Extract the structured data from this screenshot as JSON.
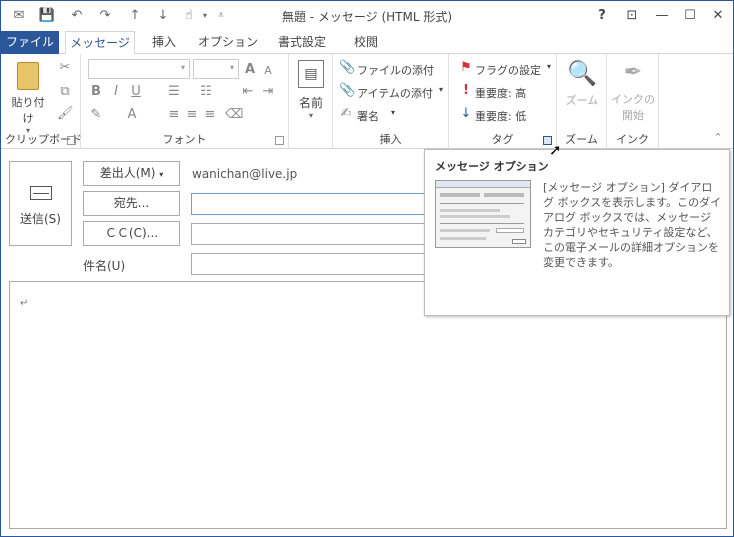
{
  "window": {
    "title": "無題 - メッセージ (HTML 形式)"
  },
  "title_controls": {
    "help": "?",
    "restore_ribbon": "⊡",
    "minimize": "—",
    "maximize": "☐",
    "close": "✕"
  },
  "tabs": [
    {
      "label": "ファイル"
    },
    {
      "label": "メッセージ"
    },
    {
      "label": "挿入"
    },
    {
      "label": "オプション"
    },
    {
      "label": "書式設定"
    },
    {
      "label": "校閲"
    }
  ],
  "ribbon": {
    "clipboard": {
      "paste": "貼り付け",
      "label": "クリップボード"
    },
    "font": {
      "label": "フォント"
    },
    "names": {
      "label": "名前"
    },
    "insert": {
      "attach_file": "ファイルの添付",
      "attach_item": "アイテムの添付",
      "signature": "署名",
      "label": "挿入"
    },
    "tags": {
      "flag": "フラグの設定",
      "high": "重要度: 高",
      "low": "重要度: 低",
      "label": "タグ"
    },
    "zoom": {
      "button": "ズーム",
      "label": "ズーム"
    },
    "ink": {
      "button_line1": "インクの",
      "button_line2": "開始",
      "label": "インク"
    }
  },
  "compose": {
    "send": "送信(S)",
    "from_button": "差出人(M)",
    "from_value": "wanichan@live.jp",
    "to_button": "宛先...",
    "cc_button": "ＣＣ(C)...",
    "subject_label": "件名(U)",
    "body_mark": "↵"
  },
  "tooltip": {
    "title": "メッセージ オプション",
    "description": "[メッセージ オプション] ダイアログ ボックスを表示します。このダイアログ ボックスでは、メッセージ カテゴリやセキュリティ設定など、この電子メールの詳細オプションを変更できます。"
  },
  "colors": {
    "accent": "#2b579a",
    "flag": "#d13438",
    "importance_high": "#d13438",
    "importance_low": "#2b579a"
  }
}
